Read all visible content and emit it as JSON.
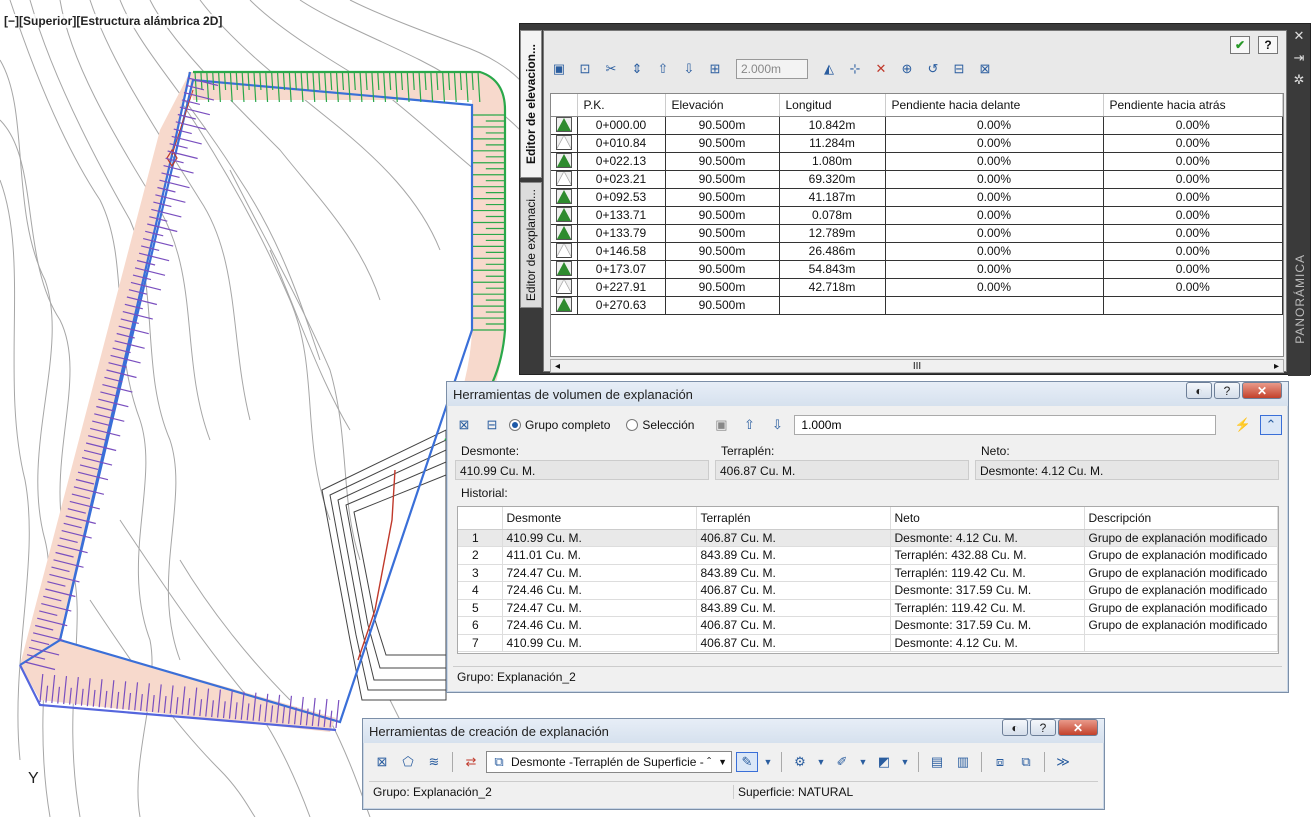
{
  "viewport": {
    "label": "[−][Superior][Estructura alámbrica 2D]",
    "axis_y": "Y"
  },
  "elevation_editor": {
    "tabs": [
      "Editor de elevacion...",
      "Editor de explanaci..."
    ],
    "step_value": "2.000m",
    "columns": [
      "P.K.",
      "Elevación",
      "Longitud",
      "Pendiente hacia delante",
      "Pendiente hacia atrás"
    ],
    "rows": [
      {
        "pk": "0+000.00",
        "elev": "90.500m",
        "len": "10.842m",
        "fwd": "0.00%",
        "back": "0.00%"
      },
      {
        "pk": "0+010.84",
        "elev": "90.500m",
        "len": "11.284m",
        "fwd": "0.00%",
        "back": "0.00%"
      },
      {
        "pk": "0+022.13",
        "elev": "90.500m",
        "len": "1.080m",
        "fwd": "0.00%",
        "back": "0.00%"
      },
      {
        "pk": "0+023.21",
        "elev": "90.500m",
        "len": "69.320m",
        "fwd": "0.00%",
        "back": "0.00%"
      },
      {
        "pk": "0+092.53",
        "elev": "90.500m",
        "len": "41.187m",
        "fwd": "0.00%",
        "back": "0.00%"
      },
      {
        "pk": "0+133.71",
        "elev": "90.500m",
        "len": "0.078m",
        "fwd": "0.00%",
        "back": "0.00%"
      },
      {
        "pk": "0+133.79",
        "elev": "90.500m",
        "len": "12.789m",
        "fwd": "0.00%",
        "back": "0.00%"
      },
      {
        "pk": "0+146.58",
        "elev": "90.500m",
        "len": "26.486m",
        "fwd": "0.00%",
        "back": "0.00%"
      },
      {
        "pk": "0+173.07",
        "elev": "90.500m",
        "len": "54.843m",
        "fwd": "0.00%",
        "back": "0.00%"
      },
      {
        "pk": "0+227.91",
        "elev": "90.500m",
        "len": "42.718m",
        "fwd": "0.00%",
        "back": "0.00%"
      },
      {
        "pk": "0+270.63",
        "elev": "90.500m",
        "len": "",
        "fwd": "",
        "back": ""
      }
    ],
    "scroll_mid": "III",
    "side_label": "PANORÁMICA"
  },
  "volume_tools": {
    "title": "Herramientas de volumen de explanación",
    "radio_group": "Grupo completo",
    "radio_selection": "Selección",
    "increment": "1.000m",
    "cut_label": "Desmonte:",
    "fill_label": "Terraplén:",
    "net_label": "Neto:",
    "cut_value": "410.99 Cu. M.",
    "fill_value": "406.87 Cu. M.",
    "net_value": "Desmonte: 4.12 Cu. M.",
    "history_label": "Historial:",
    "history_columns": [
      "",
      "Desmonte",
      "Terraplén",
      "Neto",
      "Descripción"
    ],
    "history": [
      {
        "n": "1",
        "cut": "410.99 Cu. M.",
        "fill": "406.87 Cu. M.",
        "net": "Desmonte: 4.12 Cu. M.",
        "desc": "Grupo de explanación modificado"
      },
      {
        "n": "2",
        "cut": "411.01 Cu. M.",
        "fill": "843.89 Cu. M.",
        "net": "Terraplén: 432.88 Cu. M.",
        "desc": "Grupo de explanación modificado"
      },
      {
        "n": "3",
        "cut": "724.47 Cu. M.",
        "fill": "843.89 Cu. M.",
        "net": "Terraplén: 119.42 Cu. M.",
        "desc": "Grupo de explanación modificado"
      },
      {
        "n": "4",
        "cut": "724.46 Cu. M.",
        "fill": "406.87 Cu. M.",
        "net": "Desmonte: 317.59 Cu. M.",
        "desc": "Grupo de explanación modificado"
      },
      {
        "n": "5",
        "cut": "724.47 Cu. M.",
        "fill": "843.89 Cu. M.",
        "net": "Terraplén: 119.42 Cu. M.",
        "desc": "Grupo de explanación modificado"
      },
      {
        "n": "6",
        "cut": "724.46 Cu. M.",
        "fill": "406.87 Cu. M.",
        "net": "Desmonte: 317.59 Cu. M.",
        "desc": "Grupo de explanación modificado"
      },
      {
        "n": "7",
        "cut": "410.99 Cu. M.",
        "fill": "406.87 Cu. M.",
        "net": "Desmonte: 4.12 Cu. M.",
        "desc": ""
      }
    ],
    "status_group": "Grupo: Explanación_2"
  },
  "creation_tools": {
    "title": "Herramientas de creación de explanación",
    "criteria": "Desmonte -Terraplén de Superficie - ˆ",
    "status_group": "Grupo: Explanación_2",
    "status_surface": "Superficie: NATURAL"
  },
  "colors": {
    "grading_blue": "#3a6fd8",
    "grading_green": "#2aa84a",
    "hatch_red": "#c0392b",
    "contour": "#9a9a9a"
  }
}
